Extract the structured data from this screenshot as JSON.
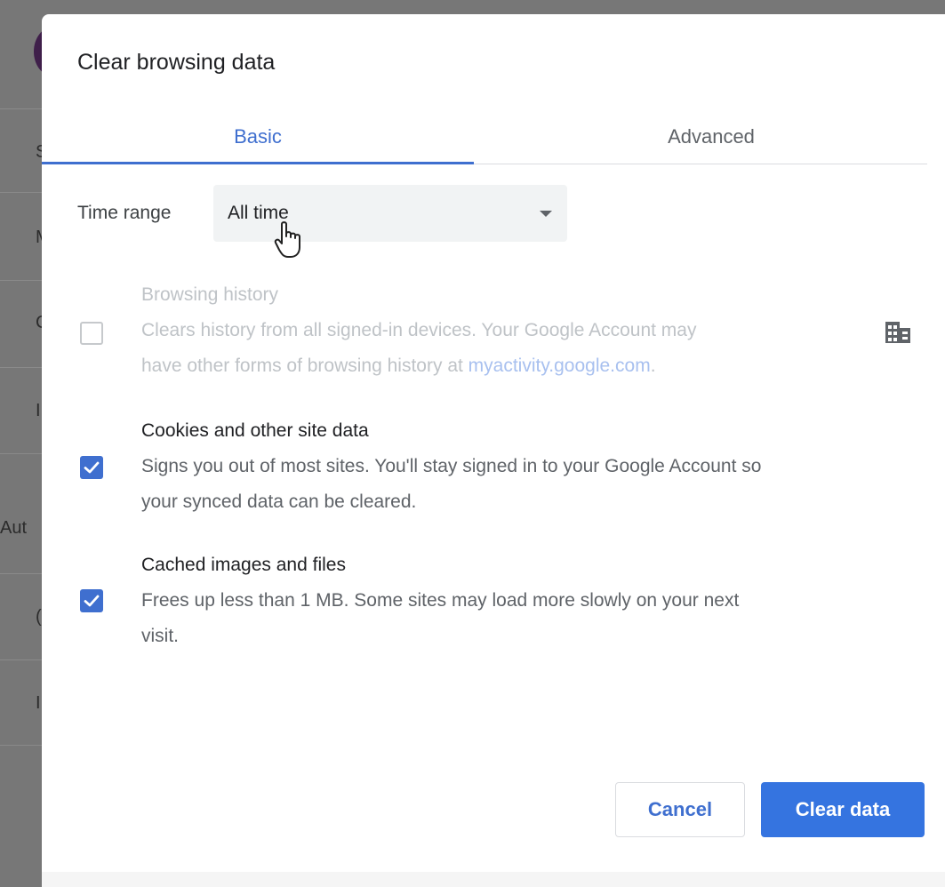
{
  "background": {
    "fragments": [
      "S",
      "M",
      "C",
      "I",
      "Aut",
      "(",
      "I"
    ]
  },
  "dialog": {
    "title": "Clear browsing data",
    "tabs": [
      {
        "label": "Basic",
        "selected": true
      },
      {
        "label": "Advanced",
        "selected": false
      }
    ],
    "time_range": {
      "label": "Time range",
      "value": "All time"
    },
    "options": [
      {
        "title": "Browsing history",
        "desc_line1": "Clears history from all signed-in devices. Your Google Account may",
        "desc_line2_prefix": "have other forms of browsing history at ",
        "link": "myactivity.google.com",
        "desc_line2_suffix": ".",
        "checked": false,
        "disabled": true
      },
      {
        "title": "Cookies and other site data",
        "desc_line1": "Signs you out of most sites. You'll stay signed in to your Google Account so",
        "desc_line2": "your synced data can be cleared.",
        "checked": true
      },
      {
        "title": "Cached images and files",
        "desc_line1": "Frees up less than 1 MB. Some sites may load more slowly on your next",
        "desc_line2": "visit.",
        "checked": true
      }
    ],
    "buttons": {
      "cancel": "Cancel",
      "clear": "Clear data"
    },
    "accent_color": "#3f6fcf",
    "primary_button_color": "#3574e0"
  }
}
